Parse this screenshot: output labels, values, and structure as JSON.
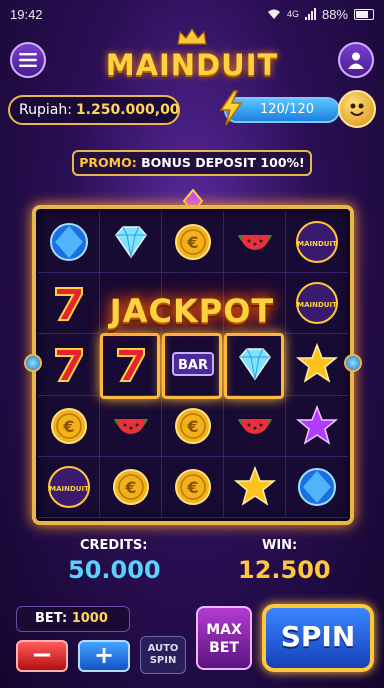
{
  "status_bar": {
    "time": "19:42",
    "network": "4G",
    "battery": "88%"
  },
  "header": {
    "title": "MAINDUIT"
  },
  "balance": {
    "label": "Rupiah:",
    "value": "1.250.000,00"
  },
  "energy": {
    "text": "120/120",
    "current": 120,
    "max": 120
  },
  "promo": {
    "label": "PROMO:",
    "text": "BONUS DEPOSIT 100%!"
  },
  "reels": {
    "rows": [
      [
        "blue-orb",
        "diamond",
        "gold-coin",
        "watermelon",
        "mainduit-badge"
      ],
      [
        "red-seven",
        "empty",
        "empty",
        "empty",
        "mainduit-badge"
      ],
      [
        "red-seven",
        "red-seven",
        "bar",
        "diamond",
        "gold-star"
      ],
      [
        "gold-coin",
        "watermelon",
        "gold-coin",
        "watermelon",
        "purple-star"
      ],
      [
        "mainduit-badge",
        "gold-coin",
        "gold-coin",
        "gold-star",
        "blue-orb"
      ]
    ],
    "badge_text": "MAINDUIT",
    "bar_text": "BAR",
    "coin_text": "€"
  },
  "jackpot": "JACKPOT",
  "credits": {
    "label": "CREDITS:",
    "value": "50.000"
  },
  "win": {
    "label": "WIN:",
    "value": "12.500"
  },
  "bet": {
    "label": "BET:",
    "value": "1000"
  },
  "controls": {
    "minus": "−",
    "plus": "+",
    "auto_line1": "AUTO",
    "auto_line2": "SPIN",
    "max_line1": "MAX",
    "max_line2": "BET",
    "spin": "SPIN"
  },
  "colors": {
    "accent_gold": "#ffd23d",
    "frame": "#e9b64a",
    "credits": "#58d2ff",
    "win": "#ffc83a"
  }
}
